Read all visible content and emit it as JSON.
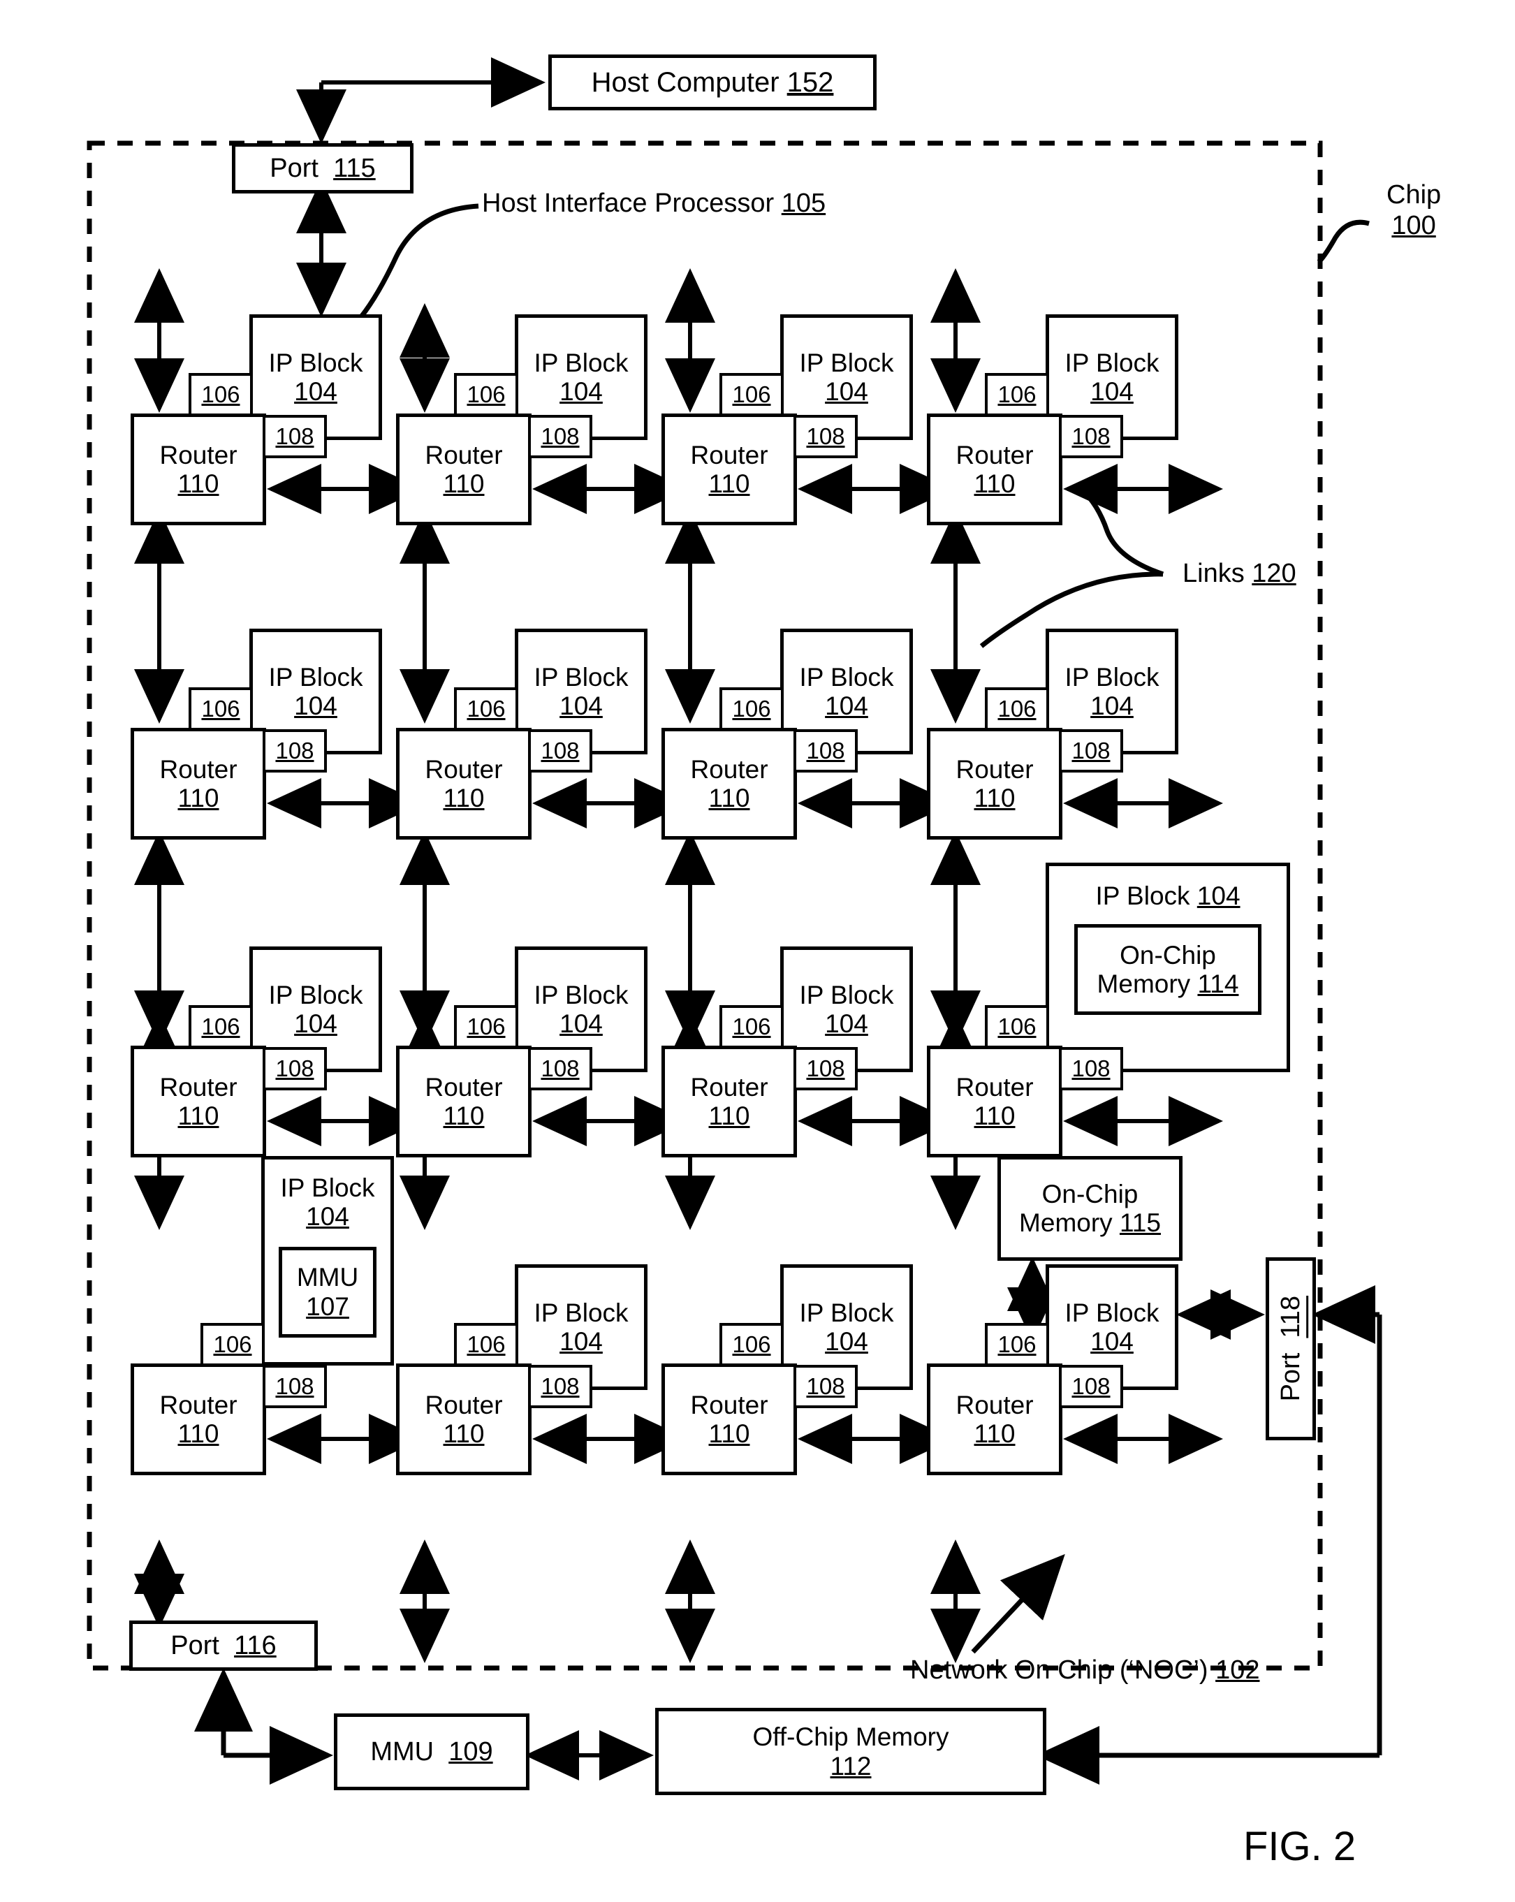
{
  "figure": {
    "caption": "FIG. 2"
  },
  "host": {
    "label": "Host Computer",
    "num": "152"
  },
  "chip": {
    "label": "Chip",
    "num": "100"
  },
  "noc": {
    "label": "Network On Chip (‘NOC’)",
    "num": "102"
  },
  "host_interface_processor": {
    "label": "Host Interface Processor",
    "num": "105"
  },
  "links": {
    "label": "Links",
    "num": "120"
  },
  "ports": {
    "top": {
      "label": "Port",
      "num": "115"
    },
    "bottom": {
      "label": "Port",
      "num": "116"
    },
    "right": {
      "label": "Port",
      "num": "118"
    }
  },
  "offchip": {
    "label": "Off-Chip Memory",
    "num": "112"
  },
  "mmu_offchip": {
    "label": "MMU",
    "num": "109"
  },
  "mmu_inblock": {
    "label": "MMU",
    "num": "107"
  },
  "onchip_mem_114": {
    "label": "On-Chip",
    "label2": "Memory",
    "num": "114"
  },
  "onchip_mem_115": {
    "label": "On-Chip",
    "label2": "Memory",
    "num": "115"
  },
  "cell": {
    "ip_block_label": "IP Block",
    "ip_block_num": "104",
    "router_label": "Router",
    "router_num": "110",
    "adapter_num": "106",
    "link_num": "108"
  },
  "grid": {
    "rows": 4,
    "cols": 4,
    "cells": [
      [
        {
          "type": "plain"
        },
        {
          "type": "plain"
        },
        {
          "type": "plain"
        },
        {
          "type": "plain"
        }
      ],
      [
        {
          "type": "plain"
        },
        {
          "type": "plain"
        },
        {
          "type": "plain"
        },
        {
          "type": "plain"
        }
      ],
      [
        {
          "type": "plain"
        },
        {
          "type": "plain"
        },
        {
          "type": "plain"
        },
        {
          "type": "onchip-memory-114"
        }
      ],
      [
        {
          "type": "mmu-107"
        },
        {
          "type": "plain"
        },
        {
          "type": "plain"
        },
        {
          "type": "onchip-memory-115-port"
        }
      ]
    ]
  },
  "colors": {
    "ink": "#000000",
    "paper": "#ffffff"
  }
}
